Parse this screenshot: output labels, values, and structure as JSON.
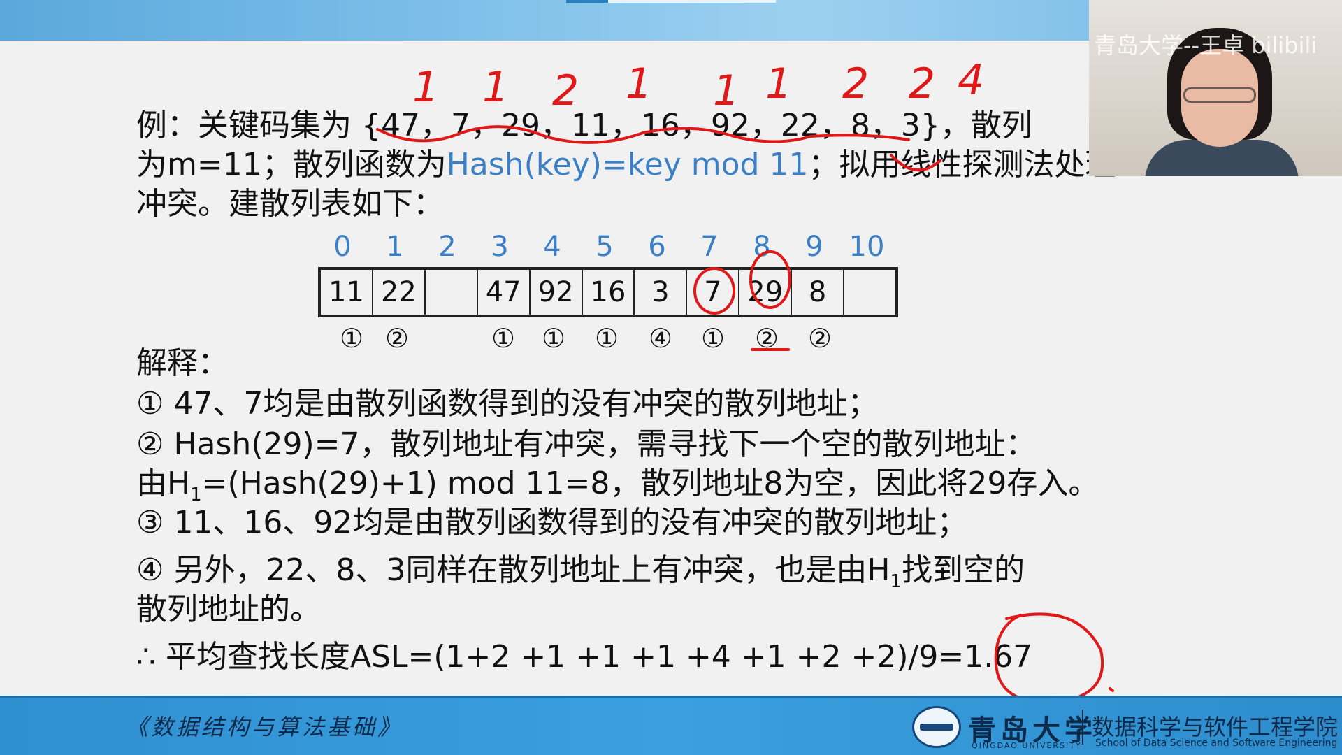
{
  "slide": {
    "line1_prefix": "例：关键码集为 {47，7，29，11，16，92，22，8，3}，散列",
    "line2_prefix": "为m=11；散列函数为",
    "line2_func": "Hash(key)=key  mod  11",
    "line2_suffix": "；拟用线性探测法处理",
    "line3": "冲突。建散列表如下：",
    "explain_title": "解释：",
    "exp1_mark": "①",
    "exp1_text": " 47、7均是由散列函数得到的没有冲突的散列地址；",
    "exp2_mark": "②",
    "exp2_text": " Hash(29)=7，散列地址有冲突，需寻找下一个空的散列地址：",
    "exp2b_pre": "由H",
    "exp2b_sub": "1",
    "exp2b_post": "=(Hash(29)+1) mod 11=8，散列地址8为空，因此将29存入。",
    "exp3_mark": "③",
    "exp3_text": " 11、16、92均是由散列函数得到的没有冲突的散列地址；",
    "exp4_mark": "④",
    "exp4_pre": " 另外，22、8、3同样在散列地址上有冲突，也是由H",
    "exp4_sub": "1",
    "exp4_post": "找到空的",
    "exp4b": "散列地址的。",
    "asl": "∴ 平均查找长度ASL=(1+2 +1 +1 +1 +4 +1 +2 +2)/9=1.67"
  },
  "table": {
    "indices": [
      "0",
      "1",
      "2",
      "3",
      "4",
      "5",
      "6",
      "7",
      "8",
      "9",
      "10"
    ],
    "cells": [
      "11",
      "22",
      "",
      "47",
      "92",
      "16",
      "3",
      "7",
      "29",
      "8",
      ""
    ],
    "probes": [
      "①",
      "②",
      "",
      "①",
      "①",
      "①",
      "④",
      "①",
      "②",
      "②",
      ""
    ]
  },
  "annotations": {
    "top_numbers": [
      "1",
      "1",
      "2",
      "1",
      "1",
      "1",
      "2",
      "2",
      "4"
    ]
  },
  "footer": {
    "course": "《数据结构与算法基础》",
    "university_cn": "青岛大学",
    "university_en": "QINGDAO UNIVERSITY",
    "school_cn": "数据科学与软件工程学院",
    "school_en": "School of Data Science and Software Engineering"
  },
  "webcam": {
    "watermark": "青岛大学--王卓 bilibili"
  },
  "colors": {
    "accent_blue": "#3b7fc6",
    "ink_red": "#e01818",
    "footer_blue": "#3aa0df"
  }
}
